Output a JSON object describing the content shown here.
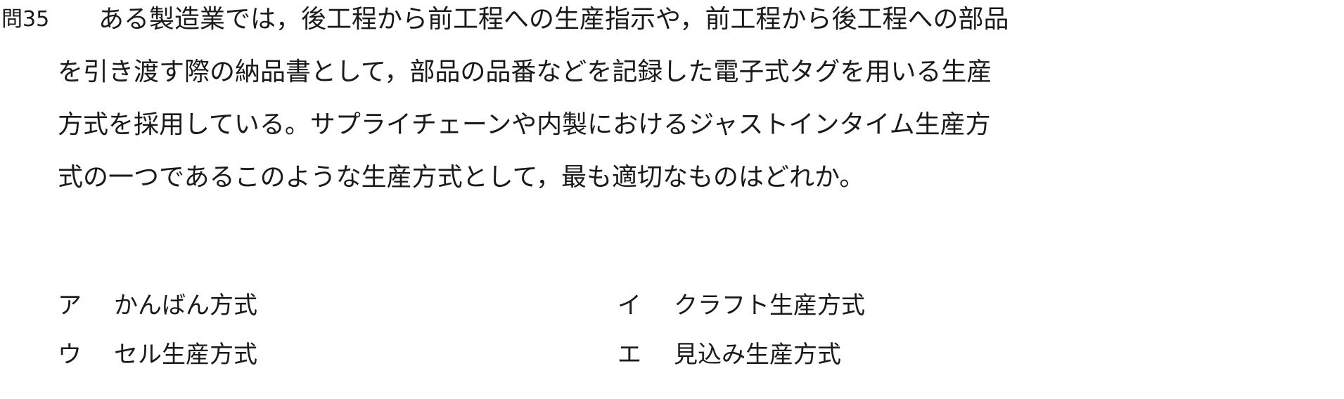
{
  "question": {
    "number": "問35",
    "lines": [
      "ある製造業では，後工程から前工程への生産指示や，前工程から後工程への部品",
      "を引き渡す際の納品書として，部品の品番などを記録した電子式タグを用いる生産",
      "方式を採用している。サプライチェーンや内製におけるジャストインタイム生産方",
      "式の一つであるこのような生産方式として，最も適切なものはどれか。"
    ]
  },
  "choices": [
    {
      "mark": "ア",
      "text": "かんばん方式"
    },
    {
      "mark": "イ",
      "text": "クラフト生産方式"
    },
    {
      "mark": "ウ",
      "text": "セル生産方式"
    },
    {
      "mark": "エ",
      "text": "見込み生産方式"
    }
  ]
}
